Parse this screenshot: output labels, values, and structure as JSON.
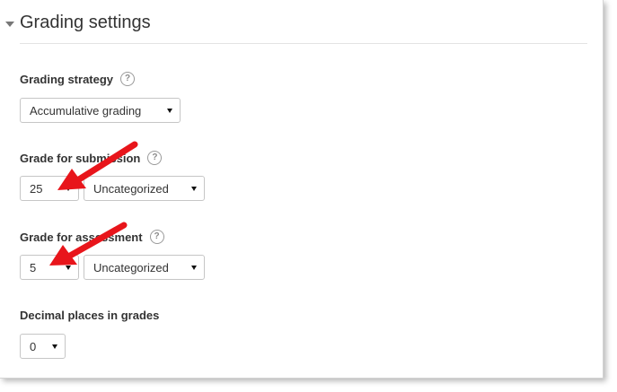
{
  "section": {
    "title": "Grading settings"
  },
  "fields": {
    "grading_strategy": {
      "label": "Grading strategy",
      "value": "Accumulative grading"
    },
    "grade_for_submission": {
      "label": "Grade for submission",
      "value": "25",
      "category": "Uncategorized"
    },
    "grade_for_assessment": {
      "label": "Grade for assessment",
      "value": "5",
      "category": "Uncategorized"
    },
    "decimal_places": {
      "label": "Decimal places in grades",
      "value": "0"
    }
  },
  "help_symbol": "?",
  "annotation_color": "#e8151b"
}
